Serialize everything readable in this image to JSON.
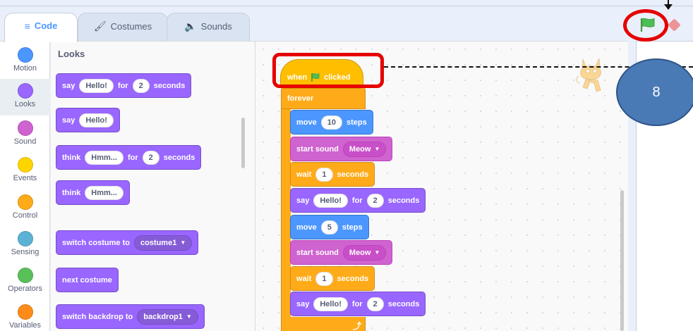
{
  "tabs": [
    {
      "label": "Code",
      "icon": "code-icon"
    },
    {
      "label": "Costumes",
      "icon": "brush-icon"
    },
    {
      "label": "Sounds",
      "icon": "speaker-icon"
    }
  ],
  "categories": [
    {
      "label": "Motion",
      "color": "#4c97ff"
    },
    {
      "label": "Looks",
      "color": "#9966ff"
    },
    {
      "label": "Sound",
      "color": "#cf63cf"
    },
    {
      "label": "Events",
      "color": "#ffd500"
    },
    {
      "label": "Control",
      "color": "#ffab19"
    },
    {
      "label": "Sensing",
      "color": "#5cb1d6"
    },
    {
      "label": "Operators",
      "color": "#59c059"
    },
    {
      "label": "Variables",
      "color": "#ff8c1a"
    }
  ],
  "palette": {
    "title": "Looks",
    "blocks": [
      {
        "parts": [
          "say",
          "Hello!",
          "for",
          "2",
          "seconds"
        ]
      },
      {
        "parts": [
          "say",
          "Hello!"
        ]
      },
      {
        "parts": [
          "think",
          "Hmm...",
          "for",
          "2",
          "seconds"
        ]
      },
      {
        "parts": [
          "think",
          "Hmm..."
        ]
      },
      {
        "parts": [
          "switch costume to",
          "costume1"
        ]
      },
      {
        "parts": [
          "next costume"
        ]
      },
      {
        "parts": [
          "switch backdrop to",
          "backdrop1"
        ]
      }
    ]
  },
  "script": {
    "hat": {
      "when": "when",
      "clicked": "clicked"
    },
    "forever": "forever",
    "blocks": [
      {
        "parts": [
          "move",
          "10",
          "steps"
        ]
      },
      {
        "parts": [
          "start sound",
          "Meow"
        ]
      },
      {
        "parts": [
          "wait",
          "1",
          "seconds"
        ]
      },
      {
        "parts": [
          "say",
          "Hello!",
          "for",
          "2",
          "seconds"
        ]
      },
      {
        "parts": [
          "move",
          "5",
          "steps"
        ]
      },
      {
        "parts": [
          "start sound",
          "Meow"
        ]
      },
      {
        "parts": [
          "wait",
          "1",
          "seconds"
        ]
      },
      {
        "parts": [
          "say",
          "Hello!",
          "for",
          "2",
          "seconds"
        ]
      }
    ]
  },
  "annotation": {
    "step_number": "8"
  },
  "colors": {
    "accent": "#4c97ff",
    "highlight": "#e60000",
    "badge": "#4a7ab5",
    "flag": "#4cbf56"
  }
}
